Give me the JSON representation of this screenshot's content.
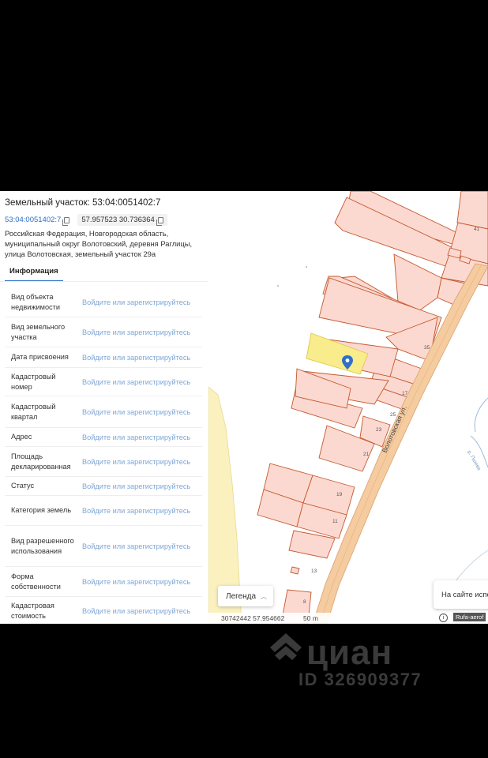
{
  "panel": {
    "title": "Земельный участок: 53:04:0051402:7",
    "cadastral_link": "53:04:0051402:7",
    "coordinates": "57.957523 30.736364",
    "address": "Российская Федерация, Новгородская область, муниципальный округ Волотовский, деревня Раглицы, улица Волотовская, земельный участок 29а",
    "tab_label": "Информация",
    "rows": [
      {
        "label": "Вид объекта недвижимости",
        "value": "Войдите или зарегистрируйтесь"
      },
      {
        "label": "Вид земельного участка",
        "value": "Войдите или зарегистрируйтесь"
      },
      {
        "label": "Дата присвоения",
        "value": "Войдите или зарегистрируйтесь"
      },
      {
        "label": "Кадастровый номер",
        "value": "Войдите или зарегистрируйтесь"
      },
      {
        "label": "Кадастровый квартал",
        "value": "Войдите или зарегистрируйтесь"
      },
      {
        "label": "Адрес",
        "value": "Войдите или зарегистрируйтесь"
      },
      {
        "label": "Площадь декларированная",
        "value": "Войдите или зарегистрируйтесь"
      },
      {
        "label": "Статус",
        "value": "Войдите или зарегистрируйтесь"
      },
      {
        "label": "Категория земель",
        "value": "Войдите или зарегистрируйтесь"
      },
      {
        "label": "Вид разрешенного использования",
        "value": "Войдите или зарегистрируйтесь"
      },
      {
        "label": "Форма собственности",
        "value": "Войдите или зарегистрируйтесь"
      },
      {
        "label": "Кадастровая стоимость",
        "value": "Войдите или зарегистрируйтесь"
      }
    ]
  },
  "map": {
    "street_label": "Волотовская ул.",
    "river_label": "р. Пшева",
    "parcel_numbers": [
      "41",
      "35",
      "21",
      "17",
      "25",
      "23",
      "19",
      "11",
      "13",
      "8"
    ],
    "legend_label": "Легенда",
    "site_info": "На сайте испо",
    "bottom_coords": "30742442 57.954662",
    "scale_label": "50 m",
    "attribution": "Rufa-aerof",
    "colors": {
      "parcel_fill": "#fcd9d0",
      "parcel_stroke": "#c4582f",
      "selected_fill": "#f8ec8c",
      "road": "#f5cba0",
      "field": "#faf1bf",
      "marker": "#2f6fc4"
    }
  },
  "watermark": {
    "brand": "циан",
    "listing_id": "ID 326909377"
  }
}
